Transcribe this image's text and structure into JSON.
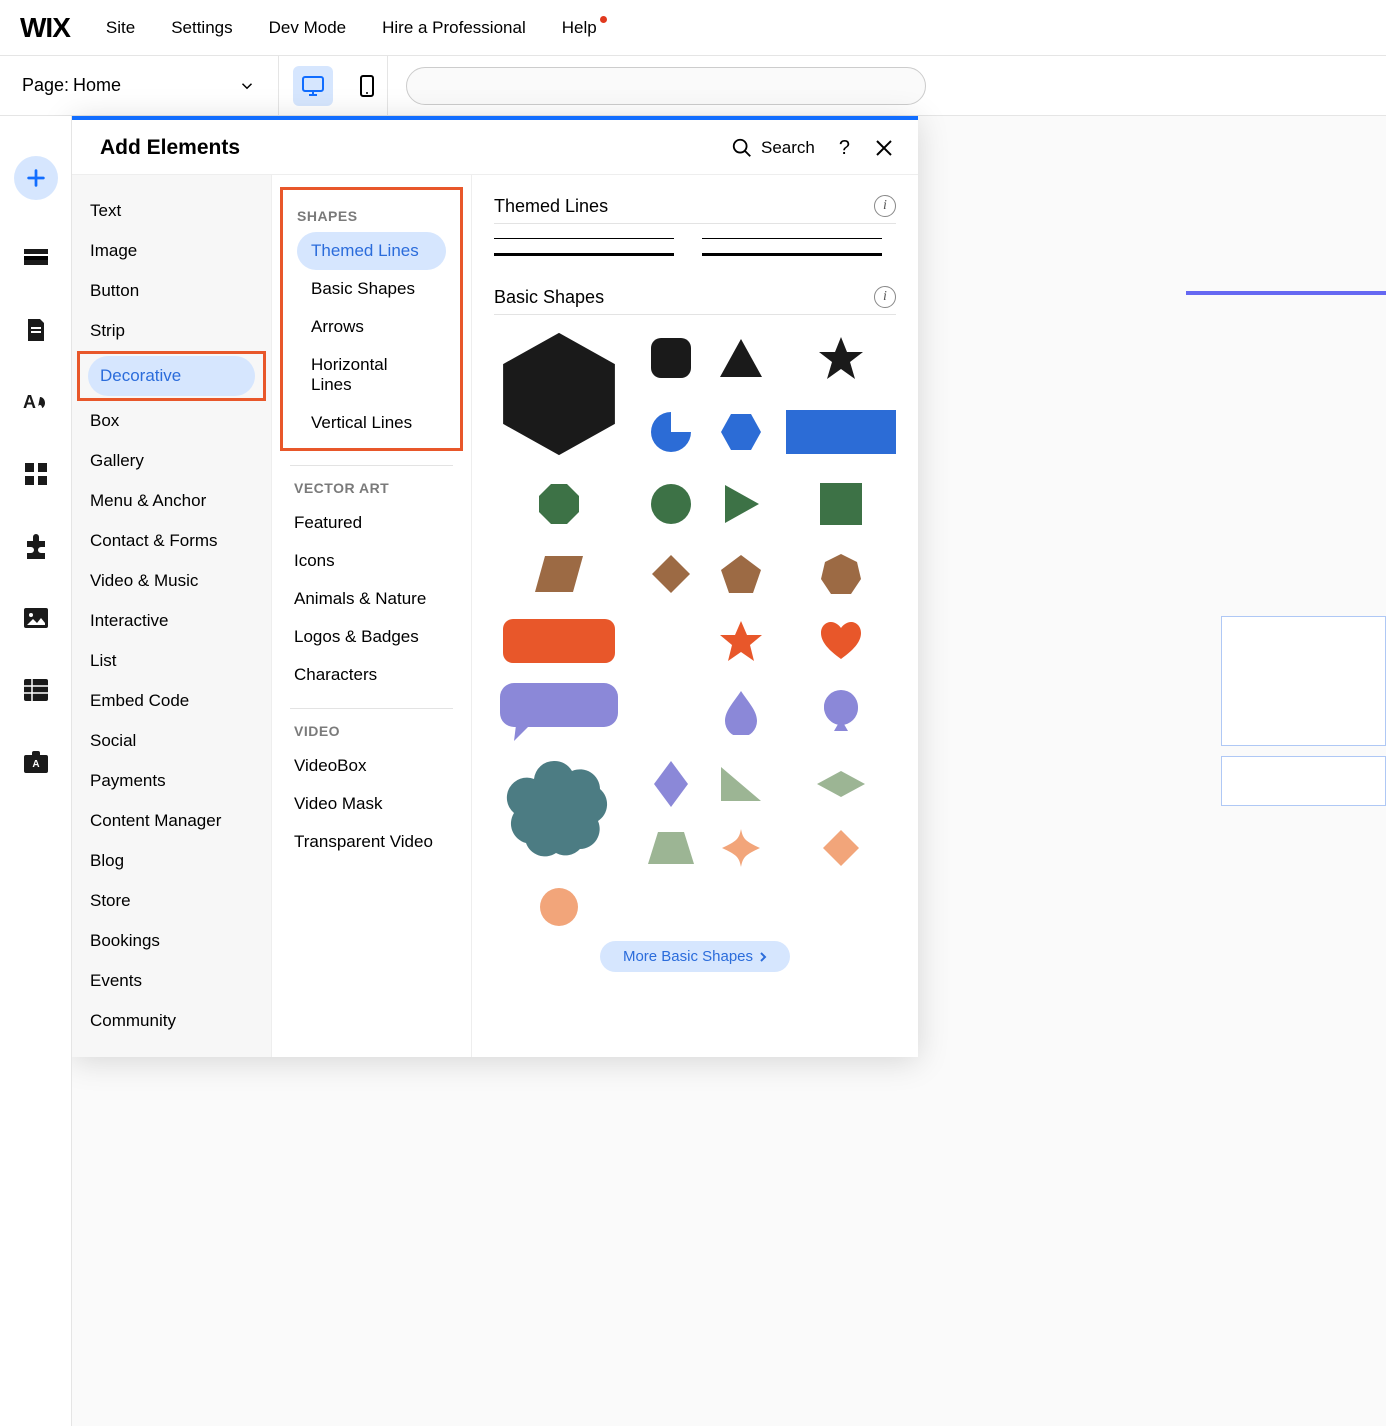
{
  "logo": "WIX",
  "topbar": {
    "site": "Site",
    "settings": "Settings",
    "devmode": "Dev Mode",
    "hire": "Hire a Professional",
    "help": "Help"
  },
  "page": {
    "prefix": "Page:",
    "name": "Home"
  },
  "panel": {
    "title": "Add Elements",
    "search": "Search",
    "categories": [
      "Text",
      "Image",
      "Button",
      "Strip",
      "Decorative",
      "Box",
      "Gallery",
      "Menu & Anchor",
      "Contact & Forms",
      "Video & Music",
      "Interactive",
      "List",
      "Embed Code",
      "Social",
      "Payments",
      "Content Manager",
      "Blog",
      "Store",
      "Bookings",
      "Events",
      "Community"
    ],
    "activeCategory": "Decorative",
    "shapesTitle": "SHAPES",
    "shapes": [
      "Themed Lines",
      "Basic Shapes",
      "Arrows",
      "Horizontal Lines",
      "Vertical Lines"
    ],
    "activeShape": "Themed Lines",
    "vectorTitle": "VECTOR ART",
    "vector": [
      "Featured",
      "Icons",
      "Animals & Nature",
      "Logos & Badges",
      "Characters"
    ],
    "videoTitle": "VIDEO",
    "video": [
      "VideoBox",
      "Video Mask",
      "Transparent Video"
    ],
    "section1": "Themed Lines",
    "section2": "Basic Shapes",
    "more": "More Basic Shapes"
  }
}
